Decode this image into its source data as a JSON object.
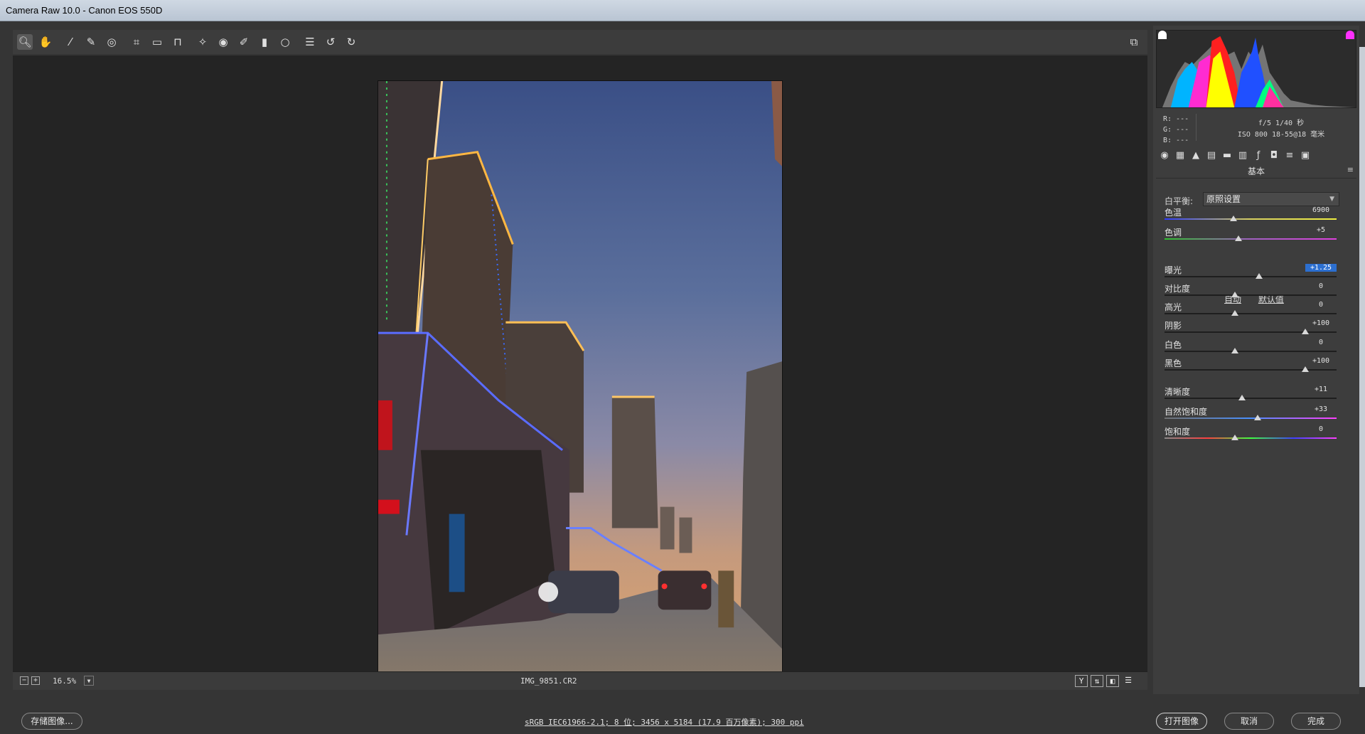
{
  "window": {
    "title": "Camera Raw 10.0  -  Canon EOS 550D"
  },
  "toolbar": {
    "tools": [
      "zoom-icon",
      "hand-icon",
      "white-balance-icon",
      "color-sampler-icon",
      "targeted-adjustment-icon",
      "crop-icon",
      "straighten-icon",
      "transform-icon",
      "spot-removal-icon",
      "red-eye-icon",
      "adjustment-brush-icon",
      "graduated-filter-icon",
      "radial-filter-icon",
      "presets-list-icon",
      "rotate-left-icon",
      "rotate-right-icon"
    ],
    "fullscreen_icon": "fullscreen-icon"
  },
  "preview": {
    "filename": "IMG_9851.CR2",
    "zoom": "16.5%",
    "compare_buttons": [
      "Y",
      "⇅",
      "◧",
      "☰"
    ]
  },
  "histogram": {
    "rgb": [
      "R:  ---",
      "G:  ---",
      "B:  ---"
    ],
    "exposure": "f/5   1/40 秒",
    "iso_lens": "ISO 800   18-55@18 毫米"
  },
  "panel": {
    "title": "基本",
    "wb_label": "白平衡:",
    "wb_value": "原照设置",
    "auto": "自动",
    "default": "默认值",
    "sliders": [
      {
        "label": "色温",
        "value": "6900",
        "pos": 0.4
      },
      {
        "label": "色调",
        "value": "+5",
        "pos": 0.43
      },
      {
        "label": "曝光",
        "value": "+1.25",
        "pos": 0.55,
        "highlight": true
      },
      {
        "label": "对比度",
        "value": "0",
        "pos": 0.41
      },
      {
        "label": "高光",
        "value": "0",
        "pos": 0.41
      },
      {
        "label": "阴影",
        "value": "+100",
        "pos": 0.82
      },
      {
        "label": "白色",
        "value": "0",
        "pos": 0.41
      },
      {
        "label": "黑色",
        "value": "+100",
        "pos": 0.82
      },
      {
        "label": "清晰度",
        "value": "+11",
        "pos": 0.45
      },
      {
        "label": "自然饱和度",
        "value": "+33",
        "pos": 0.54
      },
      {
        "label": "饱和度",
        "value": "0",
        "pos": 0.41
      }
    ]
  },
  "bottom": {
    "save": "存储图像...",
    "workflow": "sRGB IEC61966-2.1; 8 位; 3456 x 5184 (17.9 百万像素); 300 ppi",
    "open": "打开图像",
    "cancel": "取消",
    "done": "完成"
  }
}
